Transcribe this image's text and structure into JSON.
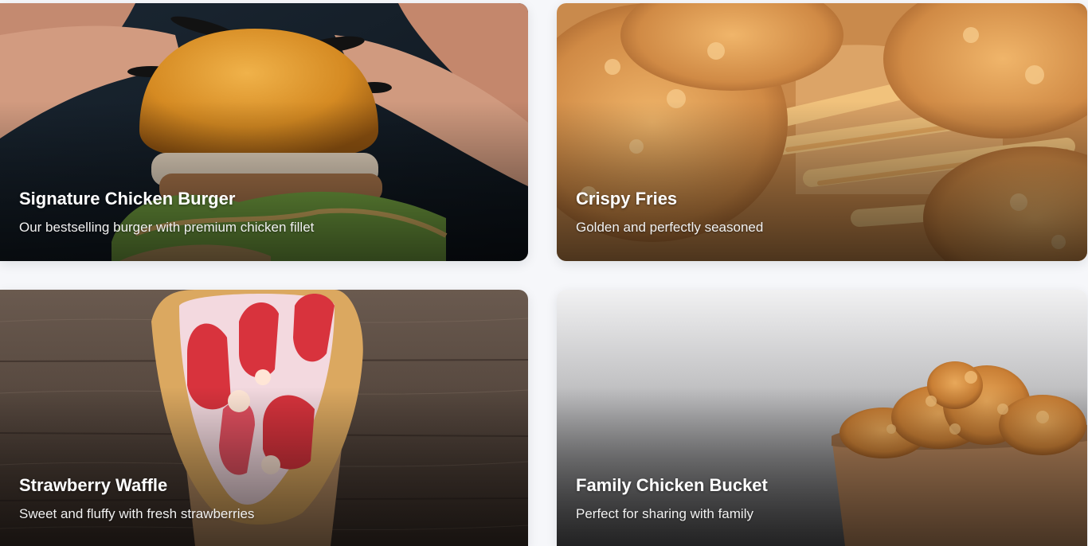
{
  "menu": {
    "cards": [
      {
        "title": "Signature Chicken Burger",
        "description": "Our bestselling burger with premium chicken fillet"
      },
      {
        "title": "Crispy Fries",
        "description": "Golden and perfectly seasoned"
      },
      {
        "title": "Strawberry Waffle",
        "description": "Sweet and fluffy with fresh strawberries"
      },
      {
        "title": "Family Chicken Bucket",
        "description": "Perfect for sharing with family"
      }
    ]
  },
  "colors": {
    "page_background": "#f6f7fa",
    "caption_text": "#ffffff"
  }
}
